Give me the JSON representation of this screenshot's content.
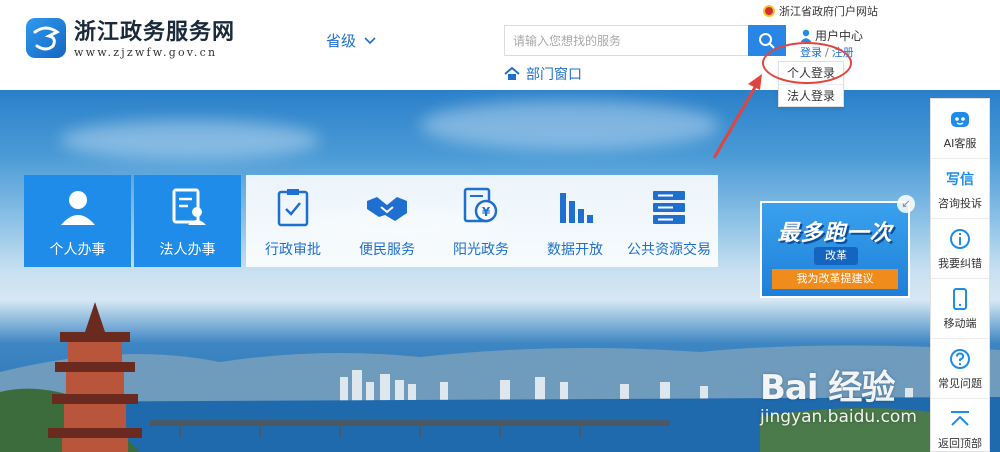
{
  "header": {
    "logo_title": "浙江政务服务网",
    "logo_url": "www.zjzwfw.gov.cn",
    "province_label": "省级",
    "gov_portal_link": "浙江省政府门户网站",
    "search_placeholder": "请输入您想找的服务",
    "dept_window_label": "部门窗口",
    "user_center_label": "用户中心",
    "login_label": "登录",
    "register_label": "注册",
    "separator": "/"
  },
  "login_dropdown": {
    "items": [
      {
        "label": "个人登录"
      },
      {
        "label": "法人登录"
      }
    ]
  },
  "services": {
    "primary": [
      {
        "label": "个人办事",
        "icon": "person-icon"
      },
      {
        "label": "法人办事",
        "icon": "corporate-doc-icon"
      }
    ],
    "secondary": [
      {
        "label": "行政审批",
        "icon": "clipboard-check-icon"
      },
      {
        "label": "便民服务",
        "icon": "handshake-icon"
      },
      {
        "label": "阳光政务",
        "icon": "document-coin-icon"
      },
      {
        "label": "数据开放",
        "icon": "bar-chart-icon"
      },
      {
        "label": "公共资源交易",
        "icon": "server-icon"
      }
    ]
  },
  "promo": {
    "title": "最多跑一次",
    "subtitle": "改革",
    "button_label": "我为改革提建议"
  },
  "sidebar": {
    "items": [
      {
        "label": "AI客服",
        "icon": "robot-icon"
      },
      {
        "label": "咨询投诉",
        "icon": "letter-icon",
        "glyph": "写信"
      },
      {
        "label": "我要纠错",
        "icon": "info-icon"
      },
      {
        "label": "移动端",
        "icon": "mobile-icon"
      },
      {
        "label": "常见问题",
        "icon": "question-icon"
      },
      {
        "label": "返回顶部",
        "icon": "back-to-top-icon"
      }
    ]
  },
  "watermark": {
    "logo": "Bai 经验",
    "url": "jingyan.baidu.com"
  },
  "colors": {
    "brand_blue": "#1f8ce9",
    "link_blue": "#1f6fd0",
    "annotation_red": "#e0453f",
    "promo_orange": "#f08c1c"
  }
}
